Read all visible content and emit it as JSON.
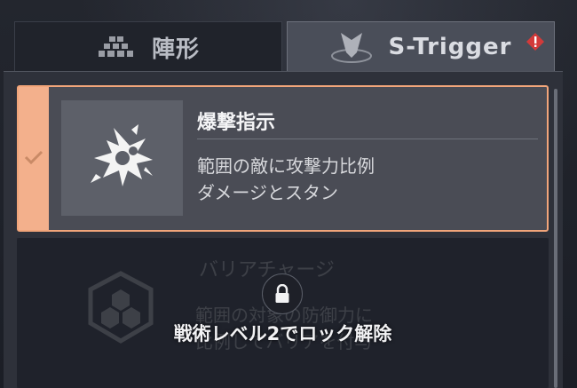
{
  "tabs": {
    "formation": {
      "label": "陣形",
      "icon": "formation-blocks-icon"
    },
    "strigger": {
      "label": "S-Trigger",
      "icon": "shield-trigger-icon",
      "alert_icon": "alert-diamond-icon"
    }
  },
  "skills": {
    "selected": {
      "name": "爆撃指示",
      "description": "範囲の敵に攻撃力比例\nダメージとスタン",
      "icon": "explosion-icon",
      "status_icon": "check-icon"
    },
    "locked": {
      "name": "バリアチャージ",
      "description": "範囲の対象の防御力に\n比例してバリアを付与",
      "icon": "hexagon-shield-icon",
      "lock_icon": "lock-icon",
      "unlock_condition": "戦術レベル2でロック解除"
    }
  },
  "colors": {
    "accent": "#f2a57a",
    "alert": "#d23a3a"
  }
}
